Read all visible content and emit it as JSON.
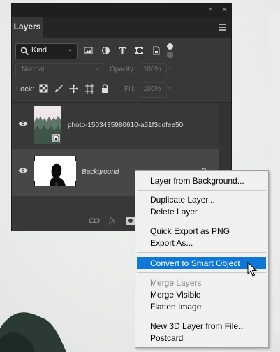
{
  "panel": {
    "tab_label": "Layers",
    "filter_kind": "Kind",
    "blend_mode": "Normal",
    "opacity_label": "Opacity:",
    "opacity_value": "100%",
    "lock_label": "Lock:",
    "fill_label": "Fill:",
    "fill_value": "100%",
    "layers": [
      {
        "name": "photo-1503435980610-a51f3ddfee50",
        "visible": true,
        "smart_object": true
      },
      {
        "name": "Background",
        "visible": true,
        "locked": true,
        "selected": true
      }
    ],
    "bottom_icons": [
      "link-icon",
      "fx-icon",
      "mask-icon"
    ]
  },
  "context_menu": {
    "items": [
      {
        "label": "Layer from Background...",
        "enabled": true
      },
      {
        "label": "Duplicate Layer...",
        "enabled": true
      },
      {
        "label": "Delete Layer",
        "enabled": true
      },
      {
        "label": "Quick Export as PNG",
        "enabled": true
      },
      {
        "label": "Export As...",
        "enabled": true
      },
      {
        "label": "Convert to Smart Object",
        "enabled": true,
        "highlighted": true
      },
      {
        "label": "Merge Layers",
        "enabled": false
      },
      {
        "label": "Merge Visible",
        "enabled": true
      },
      {
        "label": "Flatten Image",
        "enabled": true
      },
      {
        "label": "New 3D Layer from File...",
        "enabled": true
      },
      {
        "label": "Postcard",
        "enabled": true
      }
    ]
  },
  "colors": {
    "panel_bg": "#383838",
    "highlight": "#0f78d7",
    "menu_bg": "#f0f0f0"
  }
}
